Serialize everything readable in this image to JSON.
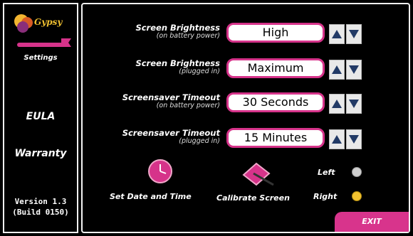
{
  "sidebar": {
    "brand_name": "Gypsy",
    "settings_label": "Settings",
    "eula_label": "EULA",
    "warranty_label": "Warranty",
    "version_line1": "Version 1.3",
    "version_line2": "(Build 0150)"
  },
  "rows": [
    {
      "title": "Screen Brightness",
      "subtitle": "(on battery power)",
      "value": "High"
    },
    {
      "title": "Screen Brightness",
      "subtitle": "(plugged in)",
      "value": "Maximum"
    },
    {
      "title": "Screensaver Timeout",
      "subtitle": "(on battery power)",
      "value": "30 Seconds"
    },
    {
      "title": "Screensaver Timeout",
      "subtitle": "(plugged in)",
      "value": "15 Minutes"
    }
  ],
  "bottom": {
    "set_date_label": "Set Date and Time",
    "calibrate_label": "Calibrate Screen",
    "left_label": "Left",
    "right_label": "Right",
    "selected_hand": "Right",
    "exit_label": "EXIT"
  },
  "colors": {
    "accent": "#d6338a",
    "radio_selected": "#f2c230",
    "radio_unselected": "#cfcfcf",
    "logo_text": "#f0c030"
  },
  "icons": {
    "logo": "gypsy-logo-icon",
    "clock": "clock-icon",
    "calibrate": "calibrate-icon",
    "arrow_up": "arrow-up-icon",
    "arrow_down": "arrow-down-icon"
  }
}
